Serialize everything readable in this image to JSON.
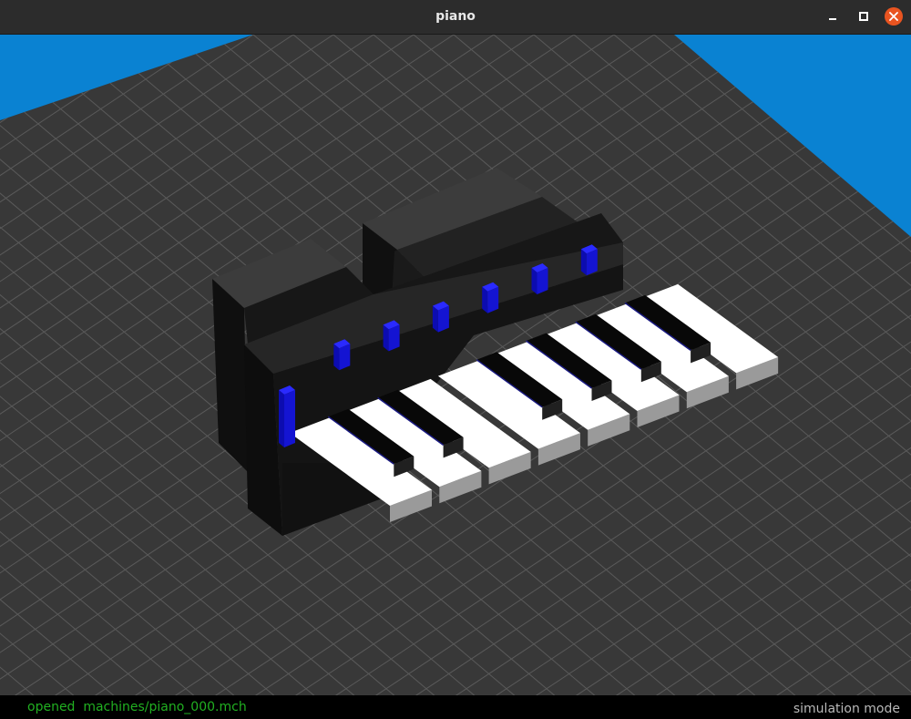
{
  "window": {
    "title": "piano"
  },
  "statusbar": {
    "left_text": "opened  machines/piano_000.mch",
    "right_text": "simulation mode"
  },
  "colors": {
    "titlebar": "#2c2c2c",
    "sky": "#0a82d2",
    "floor": "#383838",
    "grid_line": "#5a5a5a",
    "piano_body_dark": "#151515",
    "piano_body_top": "#3c3c3c",
    "white_key_top": "#ffffff",
    "white_key_side": "#9a9a9a",
    "black_key": "#080808",
    "actuator": "#1414d2",
    "close_button": "#e95420",
    "status_green": "#21b021"
  },
  "scene": {
    "objects": [
      "floor-grid",
      "piano-body",
      "white-keys",
      "black-keys",
      "actuators"
    ],
    "white_key_count": 8,
    "black_key_count": 6,
    "actuator_count": 7
  }
}
